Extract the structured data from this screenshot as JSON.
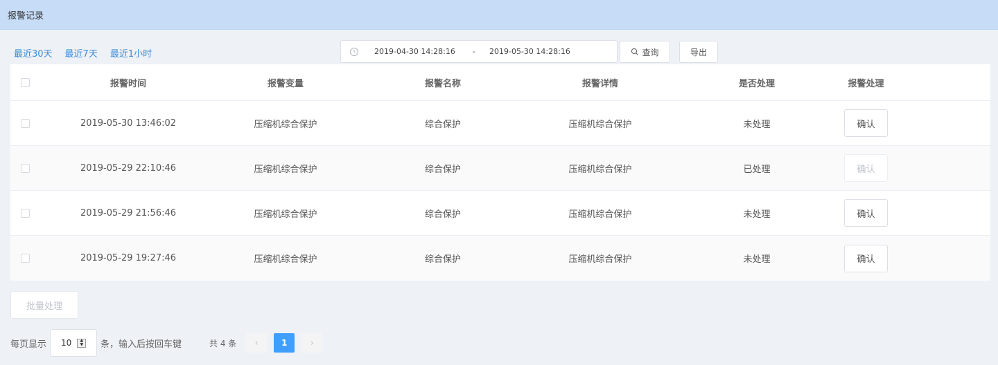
{
  "header": {
    "title": "报警记录"
  },
  "quick_ranges": [
    "最近30天",
    "最近7天",
    "最近1小时"
  ],
  "date_range": {
    "start": "2019-04-30 14:28:16",
    "separator": "-",
    "end": "2019-05-30 14:28:16"
  },
  "toolbar": {
    "query_label": "查询",
    "export_label": "导出"
  },
  "table": {
    "columns": [
      "报警时间",
      "报警变量",
      "报警名称",
      "报警详情",
      "是否处理",
      "报警处理"
    ],
    "rows": [
      {
        "time": "2019-05-30 13:46:02",
        "variable": "压缩机综合保护",
        "name": "综合保护",
        "detail": "压缩机综合保护",
        "status": "未处理",
        "action": "确认",
        "disabled": false
      },
      {
        "time": "2019-05-29 22:10:46",
        "variable": "压缩机综合保护",
        "name": "综合保护",
        "detail": "压缩机综合保护",
        "status": "已处理",
        "action": "确认",
        "disabled": true
      },
      {
        "time": "2019-05-29 21:56:46",
        "variable": "压缩机综合保护",
        "name": "综合保护",
        "detail": "压缩机综合保护",
        "status": "未处理",
        "action": "确认",
        "disabled": false
      },
      {
        "time": "2019-05-29 19:27:46",
        "variable": "压缩机综合保护",
        "name": "综合保护",
        "detail": "压缩机综合保护",
        "status": "未处理",
        "action": "确认",
        "disabled": false
      }
    ]
  },
  "batch": {
    "label": "批量处理"
  },
  "pagination": {
    "prefix": "每页显示",
    "page_size": "10",
    "suffix": "条，输入后按回车键",
    "total": "共 4 条",
    "prev": "‹",
    "current": "1",
    "next": "›"
  },
  "colors": {
    "accent": "#409eff",
    "header_bg": "#c6dcf7",
    "link": "#3a8ad6"
  }
}
